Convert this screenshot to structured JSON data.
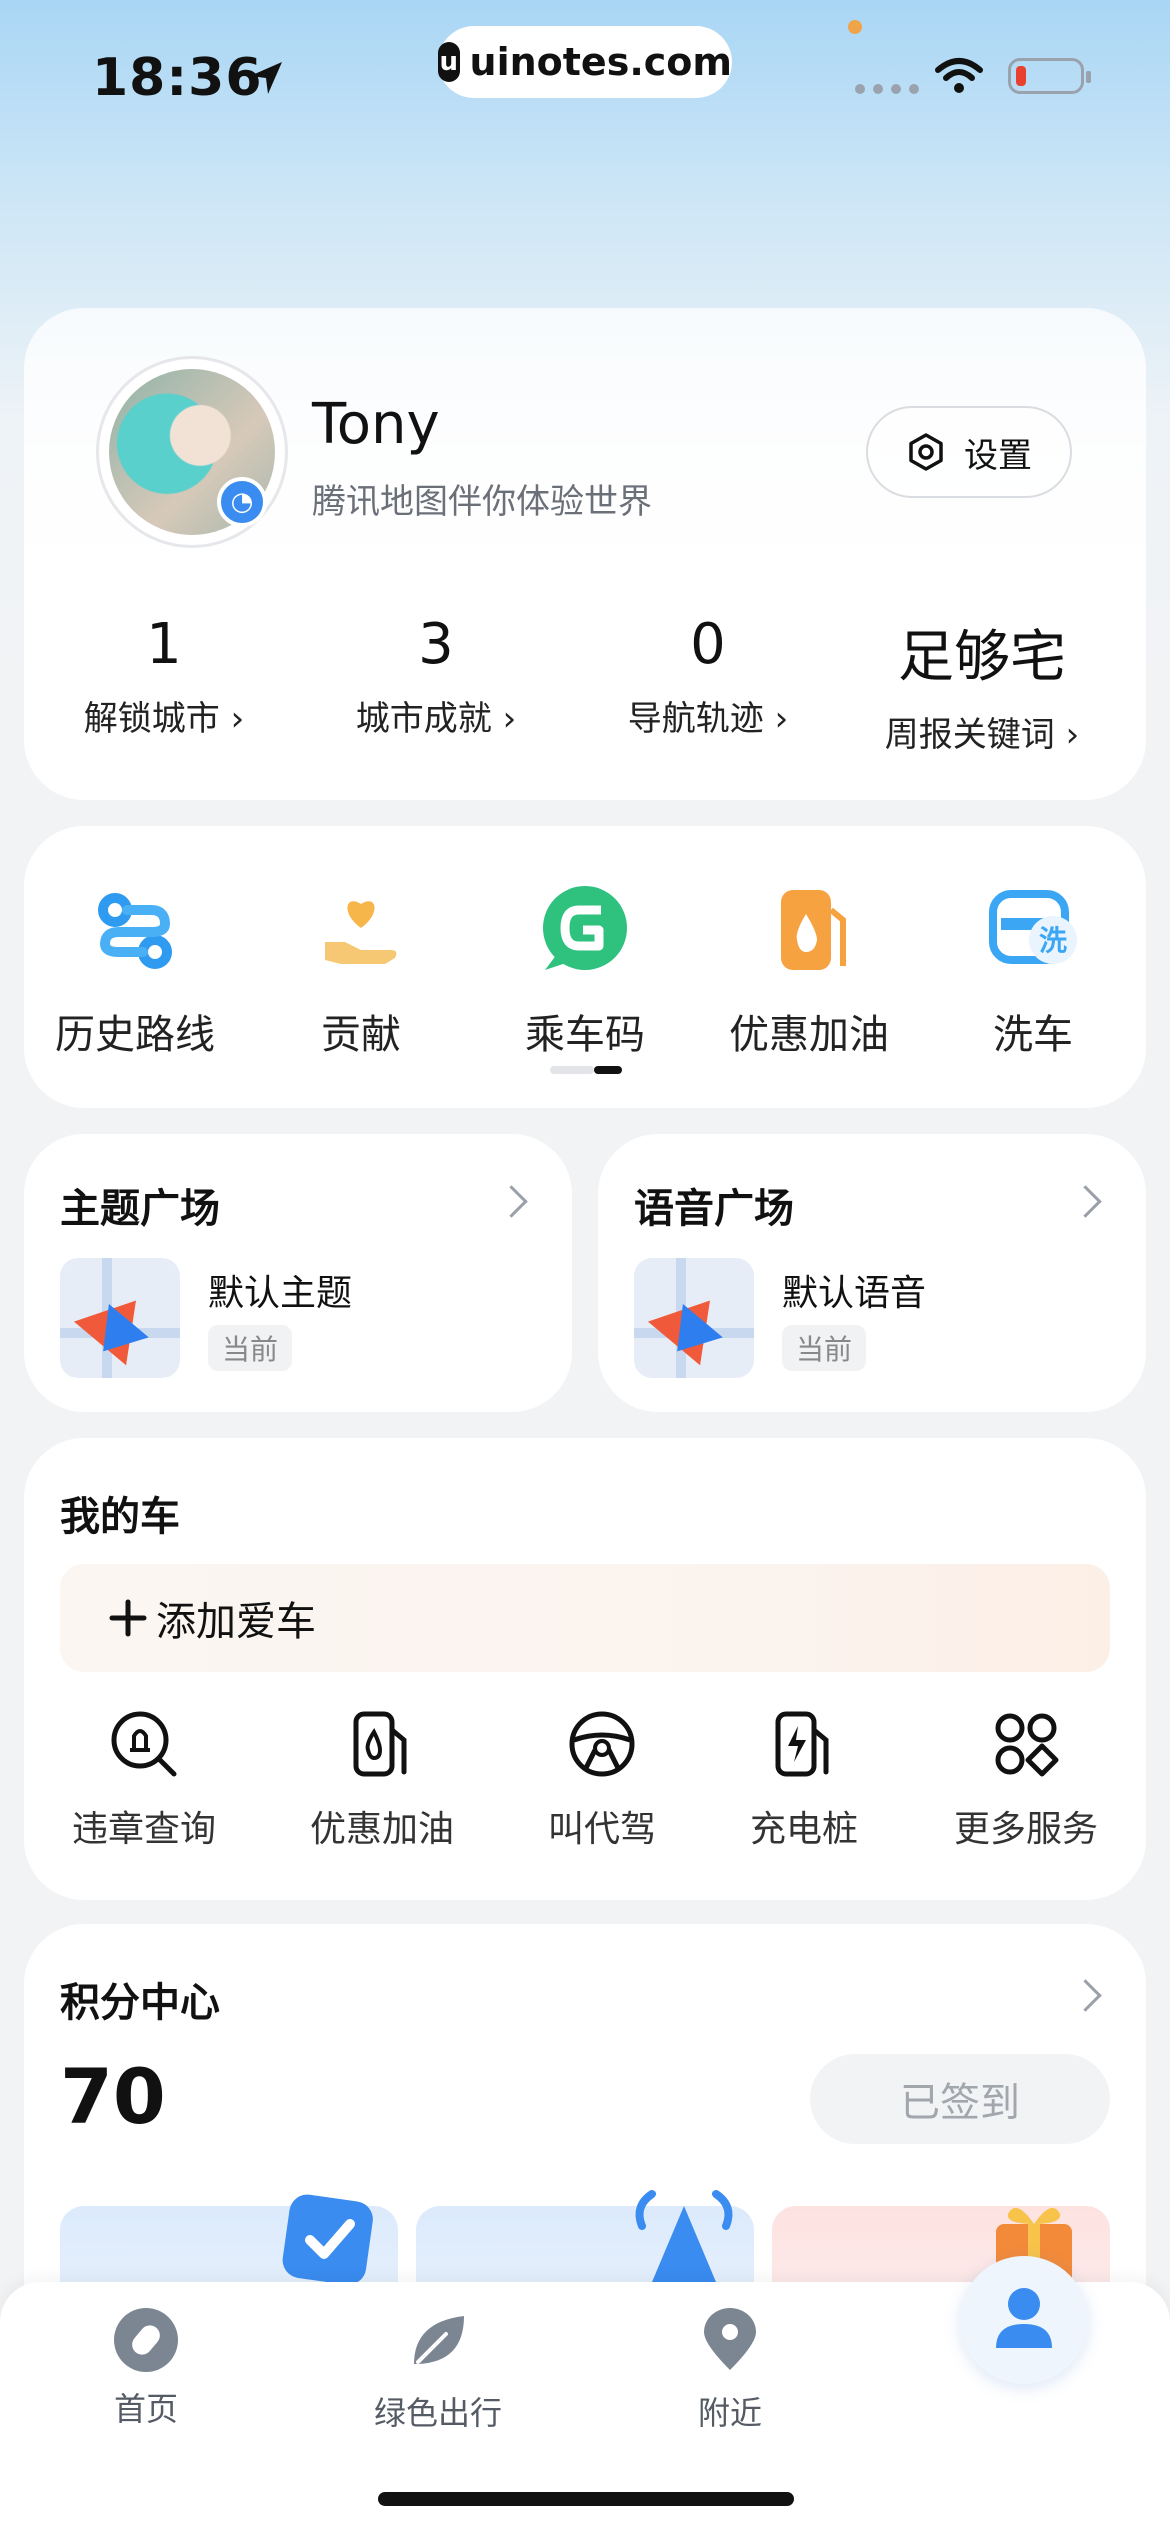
{
  "status_bar": {
    "time": "18:36",
    "url": "uinotes.com"
  },
  "profile": {
    "name": "Tony",
    "subtitle": "腾讯地图伴你体验世界",
    "settings_label": "设置",
    "stats": [
      {
        "value": "1",
        "label": "解锁城市 ›"
      },
      {
        "value": "3",
        "label": "城市成就 ›"
      },
      {
        "value": "0",
        "label": "导航轨迹 ›"
      },
      {
        "value": "足够宅",
        "label": "周报关键词 ›"
      }
    ]
  },
  "quick_actions": [
    {
      "label": "历史路线",
      "icon": "route-history-icon"
    },
    {
      "label": "贡献",
      "icon": "heart-hand-icon"
    },
    {
      "label": "乘车码",
      "icon": "ride-code-icon"
    },
    {
      "label": "优惠加油",
      "icon": "fuel-drop-icon"
    },
    {
      "label": "洗车",
      "icon": "car-wash-icon"
    }
  ],
  "theme_plaza": {
    "title": "主题广场",
    "item": "默认主题",
    "tag": "当前"
  },
  "voice_plaza": {
    "title": "语音广场",
    "item": "默认语音",
    "tag": "当前"
  },
  "my_car": {
    "title": "我的车",
    "add_label": "添加爱车",
    "services": [
      {
        "label": "违章查询",
        "icon": "violation-search-icon"
      },
      {
        "label": "优惠加油",
        "icon": "fuel-pump-icon"
      },
      {
        "label": "叫代驾",
        "icon": "steering-wheel-icon"
      },
      {
        "label": "充电桩",
        "icon": "charging-pile-icon"
      },
      {
        "label": "更多服务",
        "icon": "more-services-icon"
      }
    ]
  },
  "points_center": {
    "title": "积分中心",
    "points": "70",
    "signed_label": "已签到"
  },
  "tab_bar": [
    {
      "label": "首页",
      "icon": "compass-icon"
    },
    {
      "label": "绿色出行",
      "icon": "leaf-icon"
    },
    {
      "label": "附近",
      "icon": "location-pin-icon"
    },
    {
      "label": "",
      "icon": "profile-icon"
    }
  ],
  "colors": {
    "accent_blue": "#3a8cf0",
    "page_bg": "#f2f3f5",
    "text_dark": "#111111",
    "text_gray": "#6b7078"
  }
}
